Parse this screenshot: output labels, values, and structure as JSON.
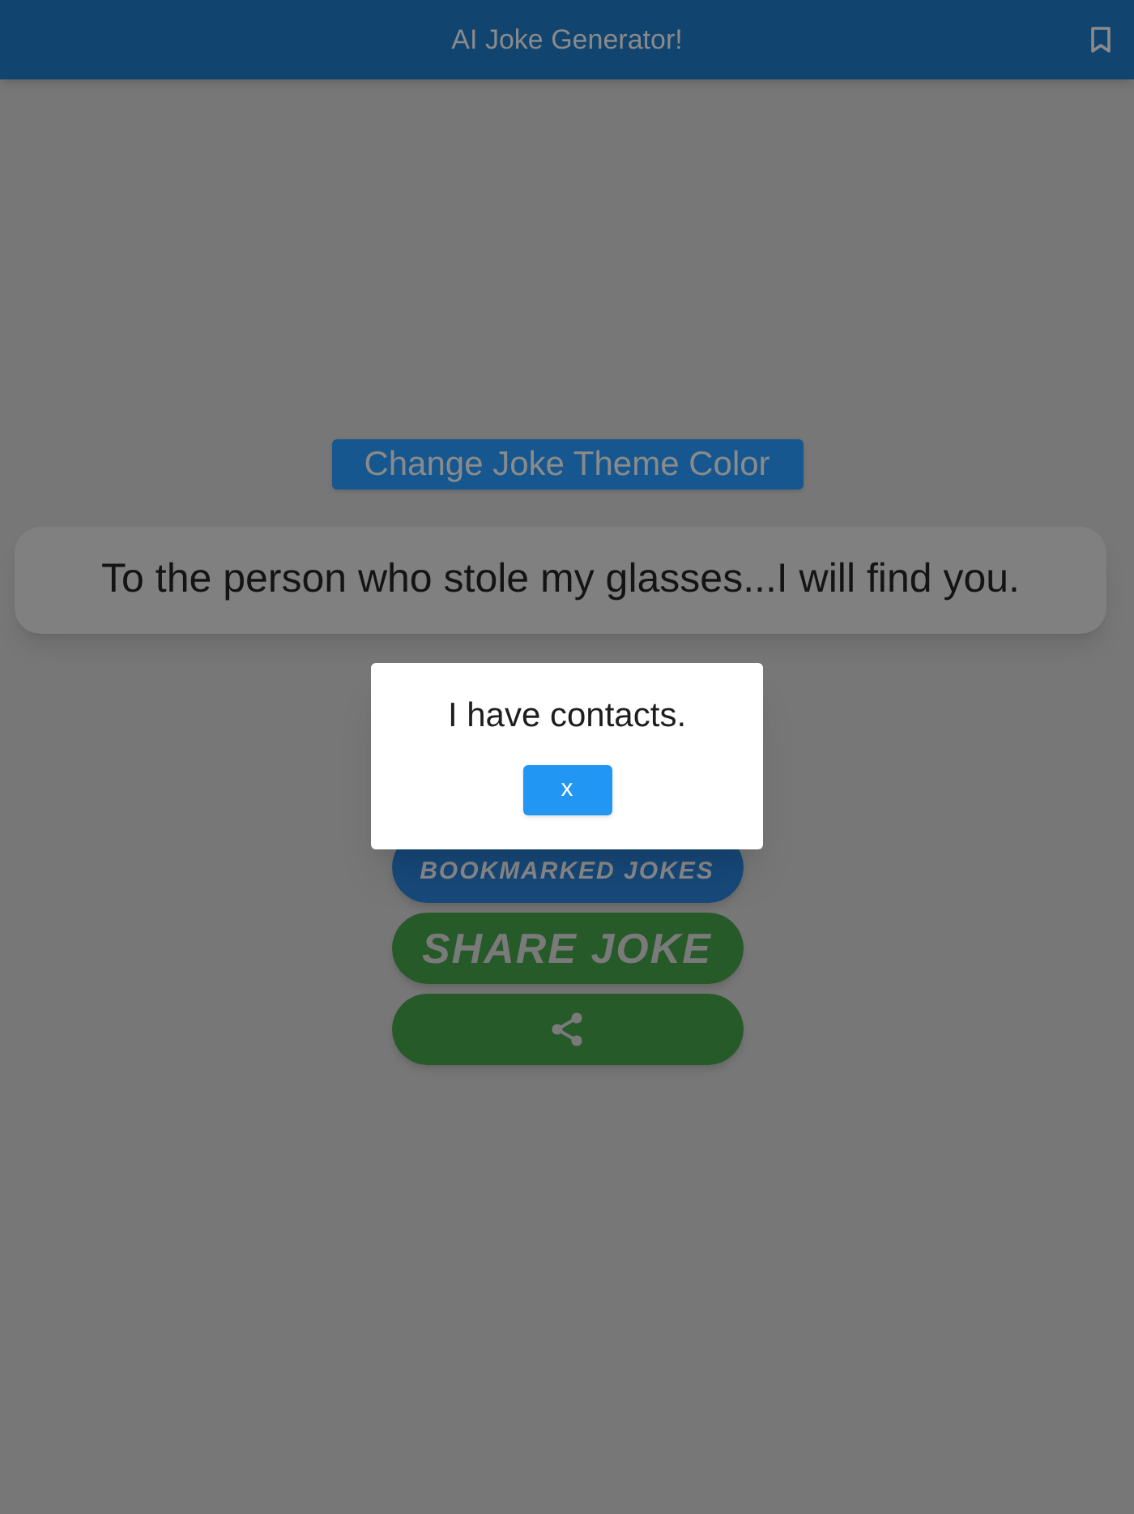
{
  "app_bar": {
    "title": "AI Joke Generator!"
  },
  "theme_button": {
    "label": "Change Joke Theme Color"
  },
  "joke": {
    "text": "To the person who stole my glasses...I will find you."
  },
  "buttons": [
    {
      "kind": "text",
      "label": "BOOKMARKED JOKES",
      "color": "#17497a"
    },
    {
      "kind": "text",
      "label": "SHARE JOKE",
      "color": "#265a29"
    },
    {
      "kind": "icon",
      "color": "#265a29"
    }
  ],
  "dialog": {
    "message": "I have contacts.",
    "close_label": "x"
  }
}
